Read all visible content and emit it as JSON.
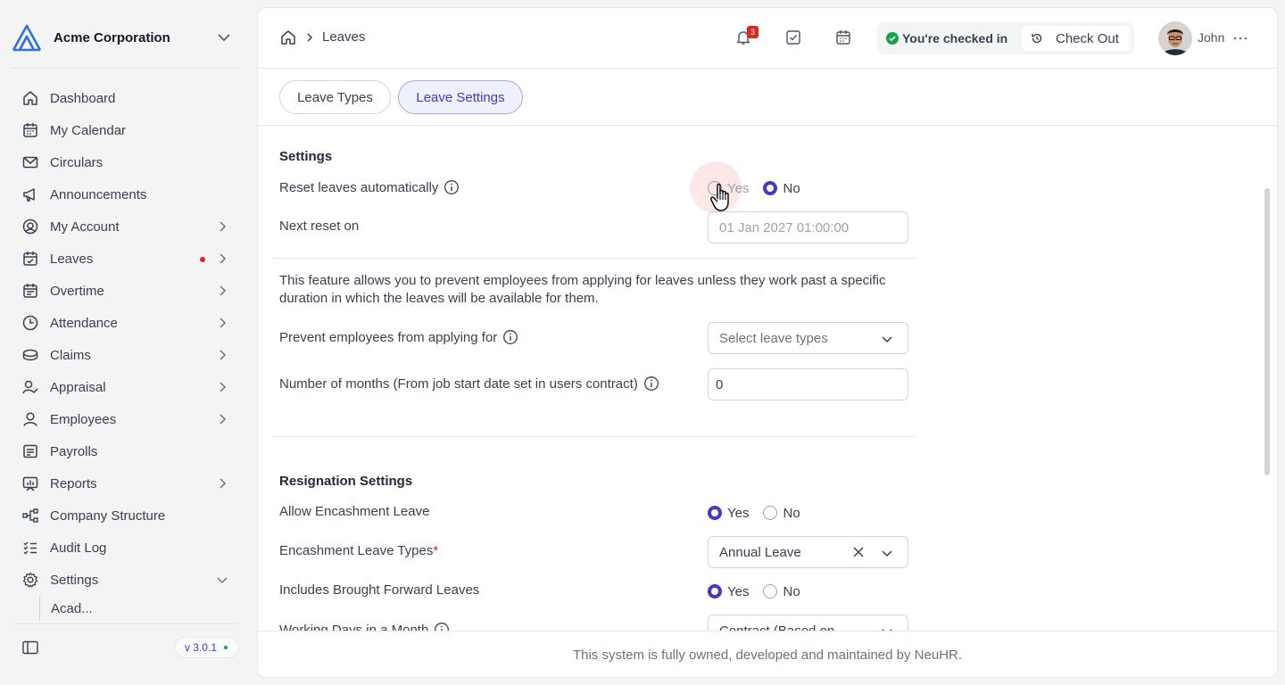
{
  "sidebar": {
    "org_name": "Acme Corporation",
    "items": [
      {
        "label": "Dashboard",
        "icon": "home-icon",
        "chevron": false
      },
      {
        "label": "My Calendar",
        "icon": "calendar-icon",
        "chevron": false
      },
      {
        "label": "Circulars",
        "icon": "mail-icon",
        "chevron": false
      },
      {
        "label": "Announcements",
        "icon": "megaphone-icon",
        "chevron": false
      },
      {
        "label": "My Account",
        "icon": "user-circle-icon",
        "chevron": true
      },
      {
        "label": "Leaves",
        "icon": "calendar-check-icon",
        "chevron": true,
        "dot": true
      },
      {
        "label": "Overtime",
        "icon": "calendar-clock-icon",
        "chevron": true
      },
      {
        "label": "Attendance",
        "icon": "clock-icon",
        "chevron": true
      },
      {
        "label": "Claims",
        "icon": "coins-icon",
        "chevron": true
      },
      {
        "label": "Appraisal",
        "icon": "user-check-icon",
        "chevron": true
      },
      {
        "label": "Employees",
        "icon": "user-icon",
        "chevron": true
      },
      {
        "label": "Payrolls",
        "icon": "receipt-icon",
        "chevron": false
      },
      {
        "label": "Reports",
        "icon": "chart-icon",
        "chevron": true
      },
      {
        "label": "Company Structure",
        "icon": "hierarchy-icon",
        "chevron": false
      },
      {
        "label": "Audit Log",
        "icon": "checklist-icon",
        "chevron": false
      },
      {
        "label": "Settings",
        "icon": "gear-icon",
        "chevron": true,
        "expanded": true
      }
    ],
    "sub_item": "Acad...",
    "version": "v 3.0.1"
  },
  "topbar": {
    "breadcrumb": "Leaves",
    "notification_count": "3",
    "checkin_status": "You're checked in",
    "checkout_label": "Check Out",
    "user_name": "John"
  },
  "tabs": [
    {
      "label": "Leave Types",
      "active": false
    },
    {
      "label": "Leave Settings",
      "active": true
    }
  ],
  "settings": {
    "title": "Settings",
    "reset_label": "Reset leaves automatically",
    "reset_value": "No",
    "yes": "Yes",
    "no": "No",
    "next_reset_label": "Next reset on",
    "next_reset_value": "01 Jan 2027 01:00:00",
    "feature_description": "This feature allows you to prevent employees from applying for leaves unless they work past a specific duration in which the leaves will be available for them.",
    "prevent_label": "Prevent employees from applying for",
    "prevent_placeholder": "Select leave types",
    "months_label": "Number of months (From job start date set in users contract)",
    "months_value": "0"
  },
  "resignation": {
    "title": "Resignation Settings",
    "allow_encashment_label": "Allow Encashment Leave",
    "allow_encashment_value": "Yes",
    "encashment_types_label": "Encashment Leave Types",
    "required_mark": "*",
    "encashment_types_value": "Annual Leave",
    "brought_forward_label": "Includes Brought Forward Leaves",
    "brought_forward_value": "Yes",
    "working_days_label": "Working Days in a Month",
    "working_days_value": "Contract (Based on..."
  },
  "footer": "This system is fully owned, developed and maintained by NeuHR.",
  "colors": {
    "accent": "#4338ca",
    "danger": "#dc2626",
    "success": "#16a34a"
  }
}
